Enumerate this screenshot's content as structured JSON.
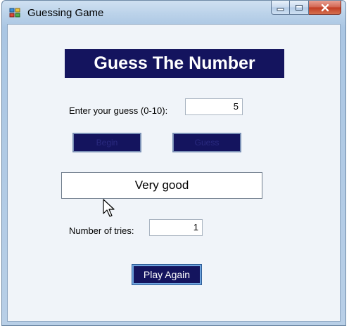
{
  "window": {
    "title": "Guessing Game",
    "icon": "form-icon",
    "controls": {
      "minimize_icon": "minimize-icon",
      "maximize_icon": "maximize-icon",
      "close_icon": "close-icon"
    }
  },
  "form": {
    "heading": "Guess The Number",
    "guess_label": "Enter your guess (0-10):",
    "guess_value": "5",
    "start_button_label": "Begin",
    "guess_button_label": "Guess",
    "result_text": "Very good",
    "tries_label": "Number of tries:",
    "tries_value": "1",
    "play_again_label": "Play Again"
  },
  "colors": {
    "heading_bg": "#14145e",
    "button_bg": "#14145e",
    "client_bg": "#f0f4f9"
  }
}
